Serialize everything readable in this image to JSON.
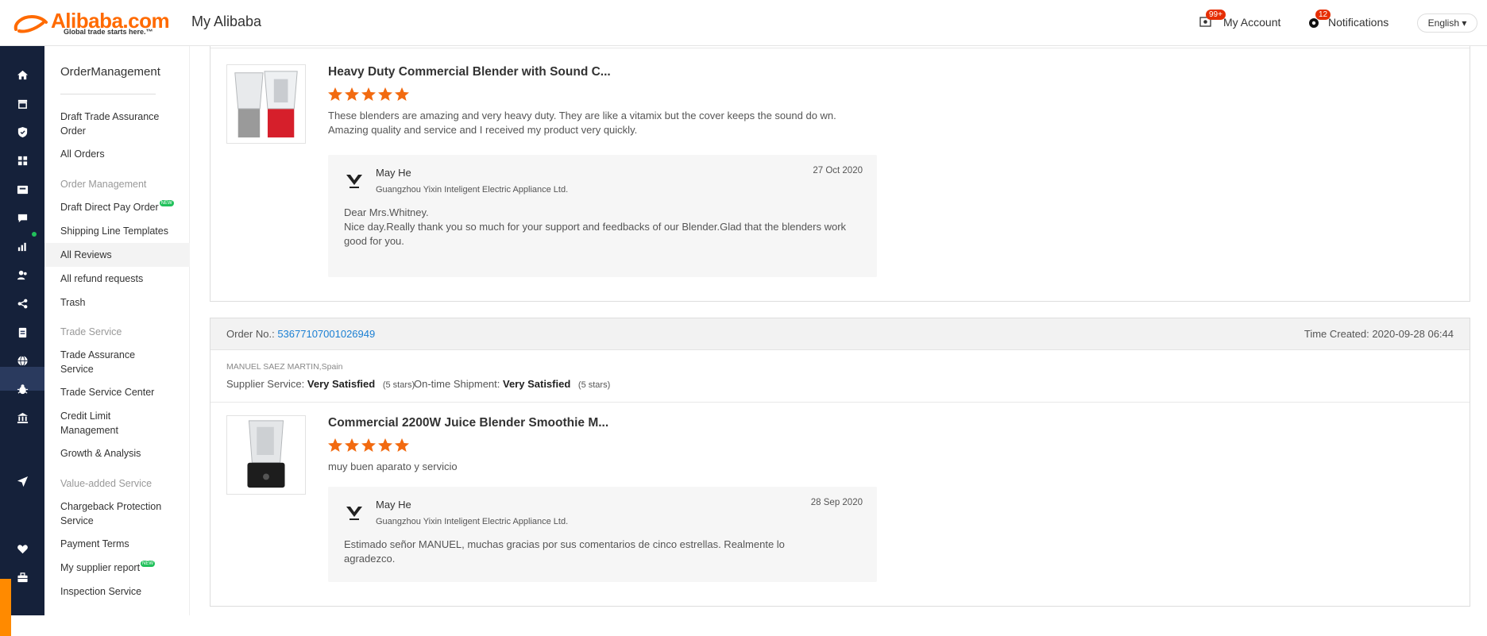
{
  "header": {
    "logo_text": "Alibaba.com",
    "logo_tagline": "Global trade starts here.™",
    "page_title": "My Alibaba",
    "account_label": "My Account",
    "account_badge": "99+",
    "notifications_label": "Notifications",
    "notifications_badge": "12",
    "language": "English ▾"
  },
  "rail": {
    "icons": [
      "home-icon",
      "store-icon",
      "shield-icon",
      "grid-icon",
      "orders-icon",
      "message-icon",
      "chart-icon",
      "users-icon",
      "logistics-icon",
      "clipboard-icon",
      "globe-icon",
      "bug-icon",
      "bank-icon",
      "send-icon",
      "heart-icon",
      "briefcase-icon"
    ]
  },
  "sidebar": {
    "title": "OrderManagement",
    "items": [
      {
        "label": "Draft Trade Assurance Order"
      },
      {
        "label": "All Orders"
      }
    ],
    "section_order": "Order Management",
    "order_items": [
      {
        "label": "Draft Direct Pay Order",
        "new": "NEW"
      },
      {
        "label": "Shipping Line Templates"
      },
      {
        "label": "All Reviews"
      },
      {
        "label": "All refund requests"
      },
      {
        "label": "Trash"
      }
    ],
    "section_trade": "Trade Service",
    "trade_items": [
      {
        "label": "Trade Assurance Service"
      },
      {
        "label": "Trade Service Center"
      },
      {
        "label": "Credit Limit Management"
      },
      {
        "label": "Growth & Analysis"
      }
    ],
    "section_value": "Value-added Service",
    "value_items": [
      {
        "label": "Chargeback Protection Service"
      },
      {
        "label": "Payment Terms"
      },
      {
        "label": "My supplier report",
        "new": "NEW"
      },
      {
        "label": "Inspection Service"
      }
    ]
  },
  "reviews": [
    {
      "product_title": "Heavy Duty Commercial Blender with Sound C...",
      "rating": 5,
      "review_text": "These blenders are amazing and very heavy duty.  They are like a vitamix but the cover keeps the sound do wn.  Amazing quality and service and I received my product very quickly.",
      "reply": {
        "name": "May He",
        "company": "Guangzhou Yixin Inteligent Electric Appliance Ltd.",
        "date": "27 Oct 2020",
        "text_lines": [
          "Dear Mrs.Whitney.",
          "Nice day.Really thank you so much for your support and feedbacks of our Blender.Glad that the blenders work good for you."
        ]
      }
    },
    {
      "order_label": "Order No.:",
      "order_no": "53677107001026949",
      "time_created": "Time Created: 2020-09-28 06:44",
      "buyer": "MANUEL SAEZ MARTIN,Spain",
      "supplier_service_label": "Supplier Service:",
      "supplier_service_value": "Very Satisfied",
      "supplier_service_stars": "(5 stars)",
      "shipment_label": "On-time Shipment:",
      "shipment_value": "Very Satisfied",
      "shipment_stars": "(5 stars)",
      "product_title": "Commercial 2200W Juice Blender Smoothie M...",
      "rating": 5,
      "review_text": "muy buen aparato y servicio",
      "reply": {
        "name": "May He",
        "company": "Guangzhou Yixin Inteligent Electric Appliance Ltd.",
        "date": "28 Sep 2020",
        "text_lines": [
          "Estimado señor MANUEL, muchas gracias por sus comentarios de cinco estrellas. Realmente lo agradezco."
        ]
      }
    }
  ],
  "colors": {
    "brand": "#ff6a00",
    "star": "#f26a10",
    "link": "#1a7fd3",
    "rail": "#15213a",
    "badge": "#e62e04",
    "new_tag": "#21c15b"
  }
}
